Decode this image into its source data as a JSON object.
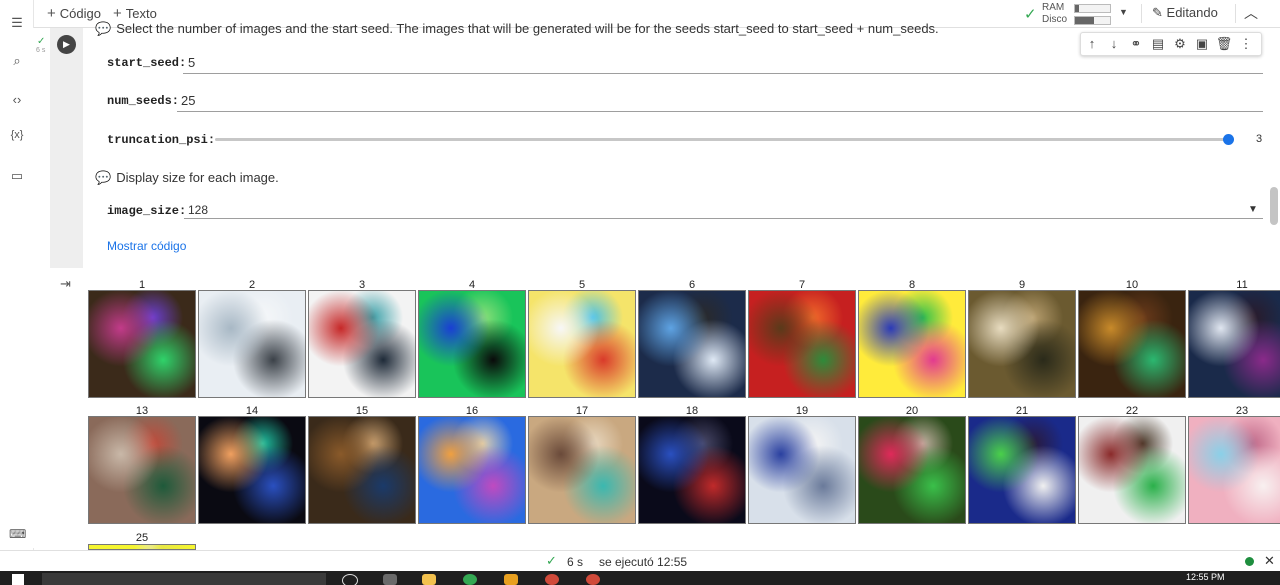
{
  "toolbar": {
    "add_code": "Código",
    "add_text": "Texto",
    "ram_label": "RAM",
    "disk_label": "Disco",
    "ram_usage": 0.1,
    "disk_usage": 0.55,
    "editing_label": "Editando"
  },
  "cell": {
    "exec_time": "6 s",
    "comment_top": "Select the number of images and the start seed. The images that will be generated will be for the seeds start_seed to start_seed + num_seeds.",
    "start_seed_label": "start_seed:",
    "start_seed_value": "5",
    "num_seeds_label": "num_seeds:",
    "num_seeds_value": "25",
    "truncation_label": "truncation_psi:",
    "truncation_value": "3",
    "truncation_level": 1.0,
    "comment_display": "Display size for each image.",
    "image_size_label": "image_size:",
    "image_size_value": "128",
    "show_code": "Mostrar código"
  },
  "output": {
    "images": [
      {
        "n": "1",
        "c": [
          "#3b2a1a",
          "#c23b8a",
          "#2fd36a",
          "#6b3fd0"
        ]
      },
      {
        "n": "2",
        "c": [
          "#e9eef3",
          "#a8b8c5",
          "#3b4148",
          "#f5f7f9"
        ]
      },
      {
        "n": "3",
        "c": [
          "#f3f3f3",
          "#c62828",
          "#1e2a38",
          "#3aa0a8"
        ]
      },
      {
        "n": "4",
        "c": [
          "#19c45a",
          "#1a3fd4",
          "#0a0a0a",
          "#8ee07a"
        ]
      },
      {
        "n": "5",
        "c": [
          "#f5e46a",
          "#f7f7f7",
          "#d93a2a",
          "#4ac1e8"
        ]
      },
      {
        "n": "6",
        "c": [
          "#1c2b4a",
          "#5ea3e3",
          "#dfe9f5",
          "#2a2a2a"
        ]
      },
      {
        "n": "7",
        "c": [
          "#c62020",
          "#5a3a1a",
          "#2e8b3a",
          "#f06a2a"
        ]
      },
      {
        "n": "8",
        "c": [
          "#ffeb3b",
          "#2b3ab8",
          "#e23a90",
          "#2fc04a"
        ]
      },
      {
        "n": "9",
        "c": [
          "#6b5a30",
          "#e8dcc0",
          "#2a2a1a",
          "#b9a070"
        ]
      },
      {
        "n": "10",
        "c": [
          "#3a2410",
          "#c88a2a",
          "#2bb870",
          "#6a3a1a"
        ]
      },
      {
        "n": "11",
        "c": [
          "#1a2a4a",
          "#e0e6f0",
          "#8a2a8a",
          "#2a1a2a"
        ]
      },
      {
        "n": "13",
        "c": [
          "#8a6a5a",
          "#c9b8a8",
          "#1e5a3a",
          "#c04a3a"
        ]
      },
      {
        "n": "14",
        "c": [
          "#0a0a12",
          "#f0a060",
          "#2a50c0",
          "#20c0a0"
        ]
      },
      {
        "n": "15",
        "c": [
          "#3a2a1a",
          "#8a5a2a",
          "#1a3a6a",
          "#c9a070"
        ]
      },
      {
        "n": "16",
        "c": [
          "#2a6ae0",
          "#f0a040",
          "#c04ac0",
          "#e0d0b0"
        ]
      },
      {
        "n": "17",
        "c": [
          "#c9a880",
          "#6a4a3a",
          "#3ab8b0",
          "#e8d8c0"
        ]
      },
      {
        "n": "18",
        "c": [
          "#0a0a1a",
          "#2a50c0",
          "#c02a2a",
          "#4a4a6a"
        ]
      },
      {
        "n": "19",
        "c": [
          "#d8e0ea",
          "#2a40a0",
          "#6a7a9a",
          "#f4f4f4"
        ]
      },
      {
        "n": "20",
        "c": [
          "#2a4a1a",
          "#e02a5a",
          "#3ac04a",
          "#c0b0a0"
        ]
      },
      {
        "n": "21",
        "c": [
          "#1a2a8a",
          "#4ad04a",
          "#f0f0f0",
          "#2a1a3a"
        ]
      },
      {
        "n": "22",
        "c": [
          "#f0f0f0",
          "#8a2a2a",
          "#2ab04a",
          "#4a3a2a"
        ]
      },
      {
        "n": "23",
        "c": [
          "#f0b0c0",
          "#8ad0e8",
          "#f8f0f0",
          "#c06a8a"
        ]
      },
      {
        "n": "25",
        "c": [
          "#f5f530",
          "#f5f530",
          "#e8e840",
          "#f0f0f0"
        ]
      }
    ]
  },
  "status": {
    "secs": "6 s",
    "text": "se ejecutó 12:55"
  },
  "taskbar": {
    "clock": "12:55 PM"
  },
  "colors": {
    "accent": "#1a73e8",
    "ok": "#34a853"
  }
}
